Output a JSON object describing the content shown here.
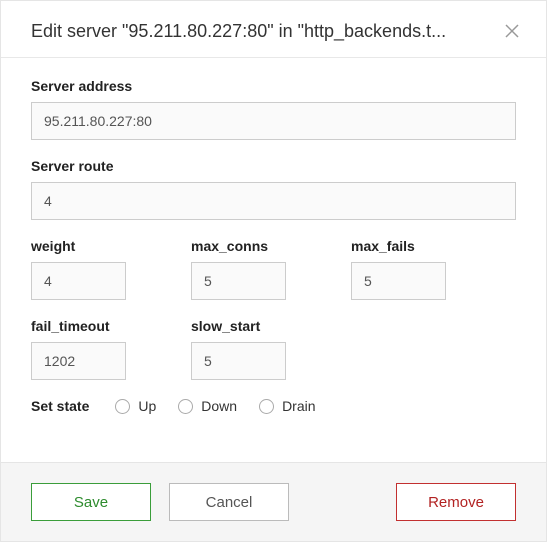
{
  "header": {
    "title": "Edit server \"95.211.80.227:80\" in \"http_backends.t..."
  },
  "fields": {
    "server_address": {
      "label": "Server address",
      "value": "95.211.80.227:80"
    },
    "server_route": {
      "label": "Server route",
      "value": "4"
    },
    "weight": {
      "label": "weight",
      "value": "4"
    },
    "max_conns": {
      "label": "max_conns",
      "value": "5"
    },
    "max_fails": {
      "label": "max_fails",
      "value": "5"
    },
    "fail_timeout": {
      "label": "fail_timeout",
      "value": "1202"
    },
    "slow_start": {
      "label": "slow_start",
      "value": "5"
    }
  },
  "state": {
    "label": "Set state",
    "options": {
      "up": "Up",
      "down": "Down",
      "drain": "Drain"
    }
  },
  "buttons": {
    "save": "Save",
    "cancel": "Cancel",
    "remove": "Remove"
  }
}
